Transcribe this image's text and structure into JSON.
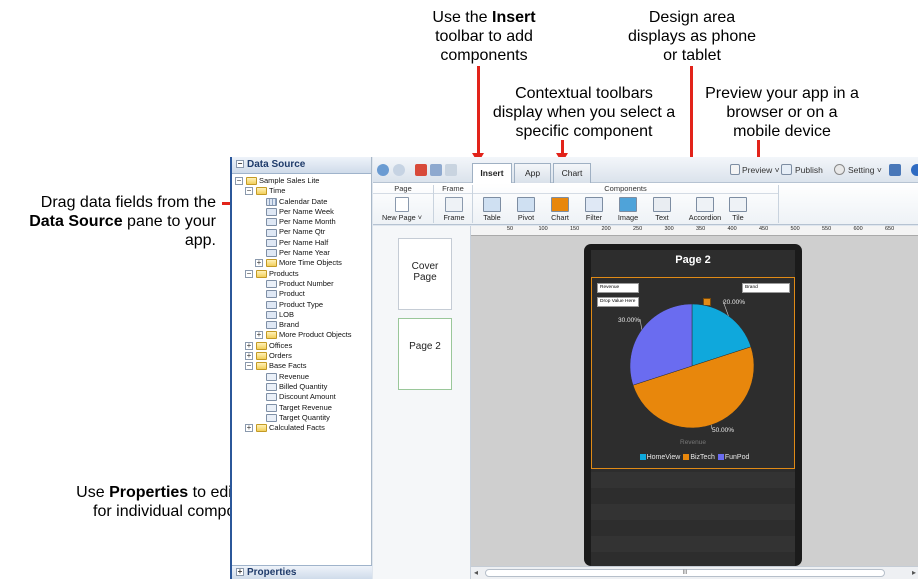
{
  "callouts": {
    "insert": {
      "pre": "Use the ",
      "bold": "Insert",
      "post": " toolbar to add components"
    },
    "design": {
      "text": "Design area displays as phone or tablet"
    },
    "contextual": {
      "text": "Contextual toolbars display when you select a specific component"
    },
    "preview": {
      "text": "Preview your app in a browser or on a mobile device"
    },
    "datasource": {
      "pre": "Drag data fields from the ",
      "bold": "Data Source",
      "post": " pane to your app."
    },
    "properties": {
      "pre": "Use ",
      "bold": "Properties",
      "post": " to edit settings for individual components."
    }
  },
  "data_source": {
    "title": "Data Source",
    "tree": [
      {
        "label": "Sample Sales Lite",
        "level": 0,
        "icon": "folder",
        "toggle": "−"
      },
      {
        "label": "Time",
        "level": 1,
        "icon": "folder",
        "toggle": "−"
      },
      {
        "label": "Calendar Date",
        "level": 2,
        "icon": "cal"
      },
      {
        "label": "Per Name Week",
        "level": 2,
        "icon": "abc"
      },
      {
        "label": "Per Name Month",
        "level": 2,
        "icon": "abc"
      },
      {
        "label": "Per Name Qtr",
        "level": 2,
        "icon": "abc"
      },
      {
        "label": "Per Name Half",
        "level": 2,
        "icon": "abc"
      },
      {
        "label": "Per Name Year",
        "level": 2,
        "icon": "abc"
      },
      {
        "label": "More Time Objects",
        "level": 2,
        "icon": "folder",
        "toggle": "+"
      },
      {
        "label": "Products",
        "level": 1,
        "icon": "folder",
        "toggle": "−"
      },
      {
        "label": "Product Number",
        "level": 2,
        "icon": "num"
      },
      {
        "label": "Product",
        "level": 2,
        "icon": "abc"
      },
      {
        "label": "Product Type",
        "level": 2,
        "icon": "abc"
      },
      {
        "label": "LOB",
        "level": 2,
        "icon": "abc"
      },
      {
        "label": "Brand",
        "level": 2,
        "icon": "abc"
      },
      {
        "label": "More Product Objects",
        "level": 2,
        "icon": "folder",
        "toggle": "+"
      },
      {
        "label": "Offices",
        "level": 1,
        "icon": "folder",
        "toggle": "+"
      },
      {
        "label": "Orders",
        "level": 1,
        "icon": "folder",
        "toggle": "+"
      },
      {
        "label": "Base Facts",
        "level": 1,
        "icon": "folder",
        "toggle": "−"
      },
      {
        "label": "Revenue",
        "level": 2,
        "icon": "num"
      },
      {
        "label": "Billed Quantity",
        "level": 2,
        "icon": "num"
      },
      {
        "label": "Discount Amount",
        "level": 2,
        "icon": "num"
      },
      {
        "label": "Target Revenue",
        "level": 2,
        "icon": "num"
      },
      {
        "label": "Target Quantity",
        "level": 2,
        "icon": "num"
      },
      {
        "label": "Calculated Facts",
        "level": 1,
        "icon": "folder",
        "toggle": "+"
      }
    ],
    "properties_label": "Properties"
  },
  "tabs": {
    "insert": "Insert",
    "app": "App",
    "chart": "Chart"
  },
  "topbar": {
    "preview": "Preview",
    "publish": "Publish",
    "setting": "Setting"
  },
  "ribbon": {
    "group_page": "Page",
    "group_frame": "Frame",
    "group_components": "Components",
    "new_page": "New Page",
    "frame": "Frame",
    "components": [
      "Table",
      "Pivot",
      "Chart",
      "Filter",
      "Image",
      "Text",
      "Accordion",
      "Tile"
    ]
  },
  "ruler_ticks": [
    "50",
    "100",
    "150",
    "200",
    "250",
    "300",
    "350",
    "400",
    "450",
    "500",
    "550",
    "600",
    "650"
  ],
  "pages": {
    "cover": "Cover Page",
    "page2": "Page 2"
  },
  "phone": {
    "title": "Page 2",
    "field_revenue": "Revenue",
    "field_drop": "Drop Value Here",
    "field_brand": "Brand",
    "measure_label": "Revenue"
  },
  "colors": {
    "HomeView": "#0fa8dc",
    "BizTech": "#e8870c",
    "FunPod": "#6a6cf0",
    "arrow": "#e2231a"
  },
  "chart_data": {
    "type": "pie",
    "categories": [
      "HomeView",
      "BizTech",
      "FunPod"
    ],
    "values": [
      20,
      50,
      30
    ],
    "labels": [
      "20.00%",
      "50.00%",
      "30.00%"
    ],
    "xlabel": "Revenue",
    "legend": "bottom"
  },
  "scrollbar_glyph": "III"
}
